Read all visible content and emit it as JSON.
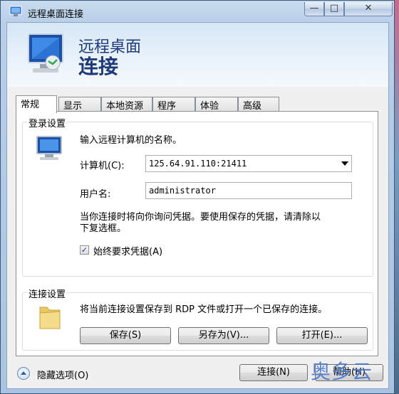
{
  "window": {
    "title": "远程桌面连接",
    "buttons": {
      "minimize": "—",
      "maximize": "□",
      "close": "✕"
    }
  },
  "banner": {
    "line1": "远程桌面",
    "line2": "连接"
  },
  "tabs": [
    {
      "label": "常规",
      "active": true
    },
    {
      "label": "显示",
      "active": false
    },
    {
      "label": "本地资源",
      "active": false
    },
    {
      "label": "程序",
      "active": false
    },
    {
      "label": "体验",
      "active": false
    },
    {
      "label": "高级",
      "active": false
    }
  ],
  "login_settings": {
    "title": "登录设置",
    "instruction": "输入远程计算机的名称。",
    "computer_label": "计算机(C):",
    "computer_value": "125.64.91.110:21411",
    "user_label": "用户名:",
    "user_value": "administrator",
    "note_line1": "当你连接时将向你询问凭据。要使用保存的凭据，请清除以",
    "note_line2": "下复选框。",
    "always_ask_label": "始终要求凭据(A)",
    "always_ask_checked": true
  },
  "connection_settings": {
    "title": "连接设置",
    "description": "将当前连接设置保存到 RDP 文件或打开一个已保存的连接。",
    "save_label": "保存(S)",
    "save_as_label": "另存为(V)...",
    "open_label": "打开(E)..."
  },
  "footer": {
    "hide_options_label": "隐藏选项(O)",
    "connect_label": "连接(N)",
    "help_label": "帮助(H)"
  },
  "watermark": "奥多云",
  "colors": {
    "banner_text": "#1e3a78",
    "accent": "#2b5fa7"
  },
  "icons": {
    "title": "remote-desktop-icon",
    "banner": "monitor-connection-icon",
    "login": "computer-icon",
    "connection": "folder-icon",
    "hide_options": "chevron-up-icon"
  }
}
